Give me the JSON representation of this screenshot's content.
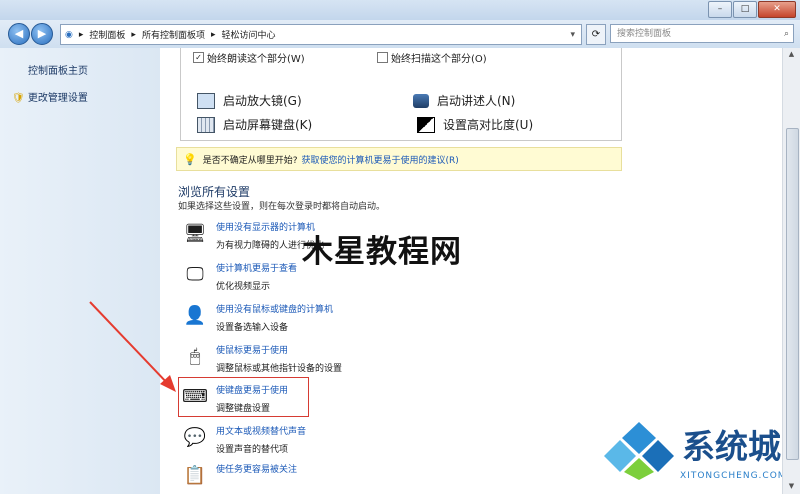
{
  "window": {
    "minimize": "–",
    "maximize": "□",
    "close": "✕"
  },
  "address": {
    "path": [
      "控制面板",
      "所有控制面板项",
      "轻松访问中心"
    ],
    "search_placeholder": "搜索控制面板"
  },
  "sidebar": {
    "items": [
      "控制面板主页",
      "更改管理设置"
    ]
  },
  "panel": {
    "checkbox_read": "始终朗读这个部分(W)",
    "checkbox_scan": "始终扫描这个部分(O)",
    "tools": [
      "启动放大镜(G)",
      "启动讲述人(N)",
      "启动屏幕键盘(K)",
      "设置高对比度(U)"
    ]
  },
  "tip": {
    "label": "是否不确定从哪里开始?",
    "link": "获取使您的计算机更易于使用的建议(R)"
  },
  "browse": {
    "title": "浏览所有设置",
    "subtitle": "如果选择这些设置，则在每次登录时都将自动启动。"
  },
  "settings": [
    {
      "title": "使用没有显示器的计算机",
      "desc": "为有视力障碍的人进行优化",
      "icon": "monitor-icon"
    },
    {
      "title": "使计算机更易于查看",
      "desc": "优化视频显示",
      "icon": "display-icon"
    },
    {
      "title": "使用没有鼠标或键盘的计算机",
      "desc": "设置备选输入设备",
      "icon": "user-icon"
    },
    {
      "title": "使鼠标更易于使用",
      "desc": "调整鼠标或其他指针设备的设置",
      "icon": "mouse-icon"
    },
    {
      "title": "使键盘更易于使用",
      "desc": "调整键盘设置",
      "icon": "keyboard-icon"
    },
    {
      "title": "用文本或视频替代声音",
      "desc": "设置声音的替代项",
      "icon": "speech-bubble-icon"
    },
    {
      "title": "使任务更容易被关注",
      "desc": "",
      "icon": "tasks-icon"
    }
  ],
  "watermark": "木星教程网",
  "logo": {
    "text": "系统城",
    "sub": "XITONGCHENG.COM"
  }
}
